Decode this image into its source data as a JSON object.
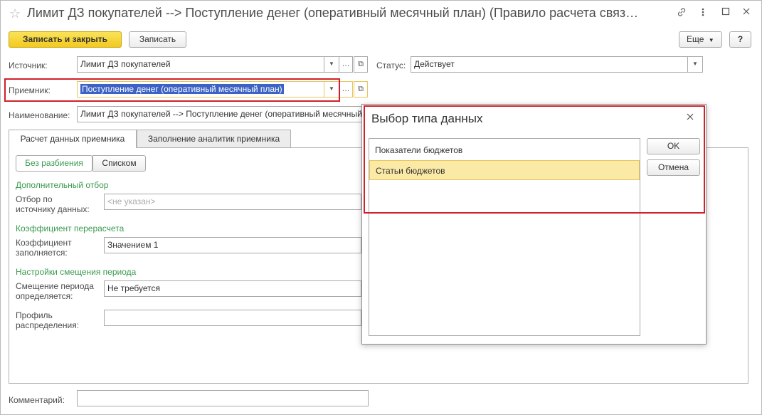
{
  "window": {
    "title": "Лимит ДЗ покупателей --> Поступление денег (оперативный месячный план) (Правило расчета связ…",
    "link_icon": "link-icon",
    "menu_icon": "more-vertical-icon",
    "maximize_icon": "maximize-icon",
    "close_icon": "close-icon"
  },
  "toolbar": {
    "save_close": "Записать и закрыть",
    "save": "Записать",
    "more": "Еще",
    "help": "?"
  },
  "form": {
    "source_label": "Источник:",
    "source_value": "Лимит ДЗ покупателей",
    "status_label": "Статус:",
    "status_value": "Действует",
    "receiver_label": "Приемник:",
    "receiver_value": "Поступление денег (оперативный месячный план)",
    "name_label": "Наименование:",
    "name_value": "Лимит ДЗ покупателей --> Поступление денег (оперативный месячный план)",
    "comment_label": "Комментарий:",
    "comment_value": ""
  },
  "tabs": [
    {
      "label": "Расчет данных приемника",
      "active": true
    },
    {
      "label": "Заполнение аналитик приемника",
      "active": false
    }
  ],
  "tab_content": {
    "split_no": "Без разбиения",
    "split_list": "Списком",
    "extra_filter_header": "Дополнительный отбор",
    "filter_label_1": "Отбор по",
    "filter_label_2": "источнику данных:",
    "filter_placeholder": "<не указан>",
    "coef_header": "Коэффициент перерасчета",
    "coef_label_1": "Коэффициент",
    "coef_label_2": "заполняется:",
    "coef_value": "Значением 1",
    "shift_header": "Настройки смещения периода",
    "shift_label_1": "Смещение периода",
    "shift_label_2": "определяется:",
    "shift_value": "Не требуется",
    "profile_label_1": "Профиль",
    "profile_label_2": "распределения:",
    "profile_value": ""
  },
  "dialog": {
    "title": "Выбор типа данных",
    "items": [
      "Показатели бюджетов",
      "Статьи бюджетов"
    ],
    "selected_index": 1,
    "ok": "OK",
    "cancel": "Отмена"
  },
  "colors": {
    "accent_red": "#d0212b",
    "primary_yellow": "#f3c91e",
    "green_header": "#3a9a4f",
    "selection_blue": "#3b62c4"
  }
}
